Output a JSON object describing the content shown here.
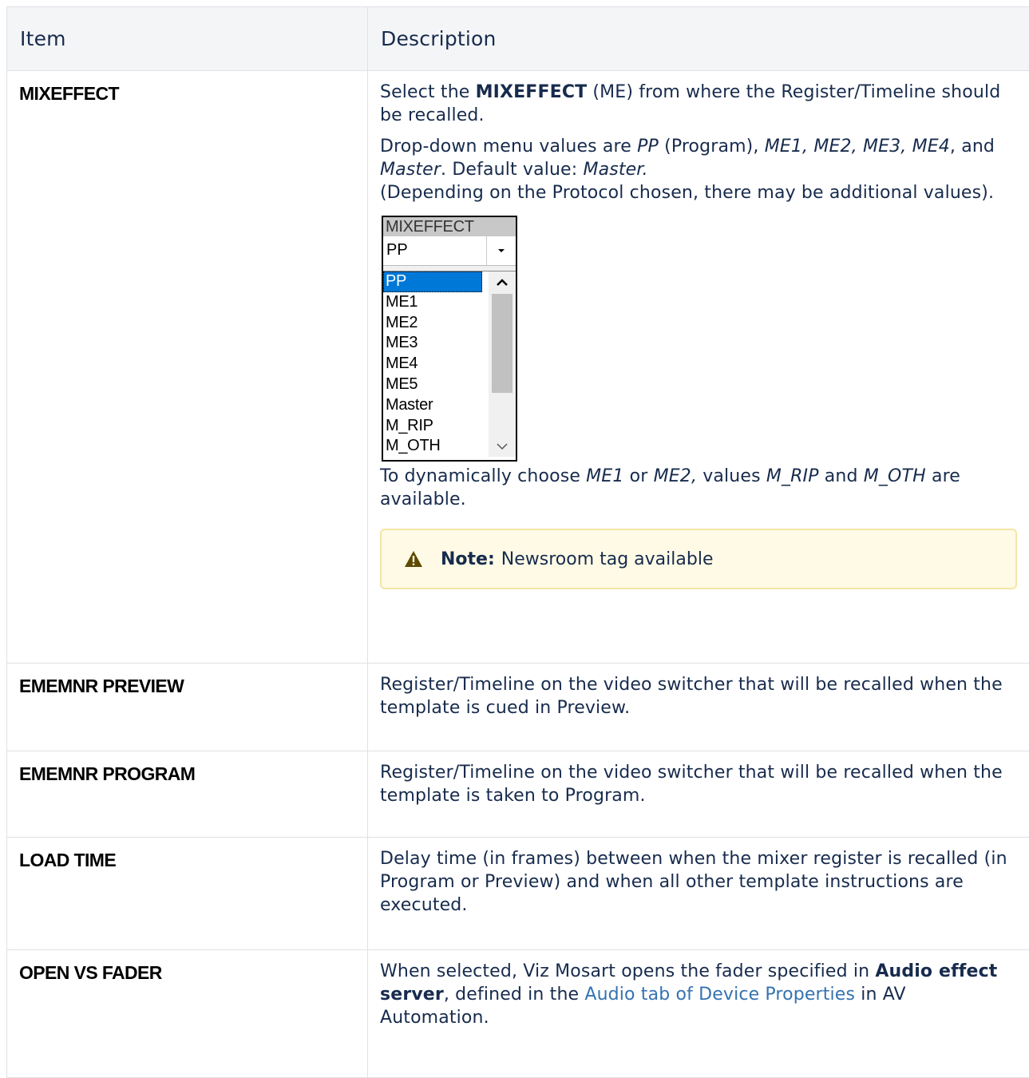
{
  "table": {
    "header_item": "Item",
    "header_description": "Description"
  },
  "rows": {
    "mixeffect": {
      "item": "MIXEFFECT",
      "p1_a": "Select the ",
      "p1_b": "MIXEFFECT",
      "p1_c": " (ME) from where the Register/Timeline should be recalled.",
      "p2_a": "Drop-down menu values are ",
      "p2_pp": "PP",
      "p2_b": " (Program), ",
      "p2_mes": "ME1, ME2, ME3, ME4",
      "p2_c": ", and ",
      "p2_master": "Master",
      "p2_d": ". Default value: ",
      "p2_default": "Master.",
      "p2_e": "(Depending on the Protocol chosen, there may be additional values).",
      "dropdown": {
        "header": "MIXEFFECT",
        "selected_value": "PP",
        "options": [
          "PP",
          "ME1",
          "ME2",
          "ME3",
          "ME4",
          "ME5",
          "Master",
          "M_RIP",
          "M_OTH"
        ],
        "highlighted_index": 0
      },
      "p3_a": "To dynamically choose ",
      "p3_me1": "ME1",
      "p3_b": " or ",
      "p3_me2": "ME2,",
      "p3_c": " values ",
      "p3_mrip": "M_RIP",
      "p3_d": " and ",
      "p3_moth": "M_OTH",
      "p3_e": " are available.",
      "note_label": "Note:",
      "note_text": "Newsroom tag available"
    },
    "preview": {
      "item": "EMEMNR PREVIEW",
      "desc": "Register/Timeline on the video switcher that will be recalled when the template is cued in Preview."
    },
    "program": {
      "item": "EMEMNR PROGRAM",
      "desc": "Register/Timeline on the video switcher that will be recalled when the template is taken to Program."
    },
    "load_time": {
      "item": "LOAD TIME",
      "desc": "Delay time (in frames) between when the mixer register is recalled (in Program or Preview) and when all other template instructions are executed."
    },
    "open_vs_fader": {
      "item": "OPEN VS FADER",
      "desc_a": "When selected, Viz Mosart opens the fader specified in ",
      "desc_b": "Audio effect server",
      "desc_c": ", defined in the ",
      "link_audio": "Audio",
      "link_tab_of": " tab of ",
      "link_device": "Device Properties",
      "desc_d": " in AV Automation."
    }
  },
  "colors": {
    "header_bg": "#f4f5f7",
    "border": "#dfe1e6",
    "text": "#172b4d",
    "link": "#3572b0",
    "note_bg": "#fffae6",
    "note_border": "#f5e5a5",
    "warning_icon": "#5e4a03",
    "selection": "#0078d7"
  }
}
